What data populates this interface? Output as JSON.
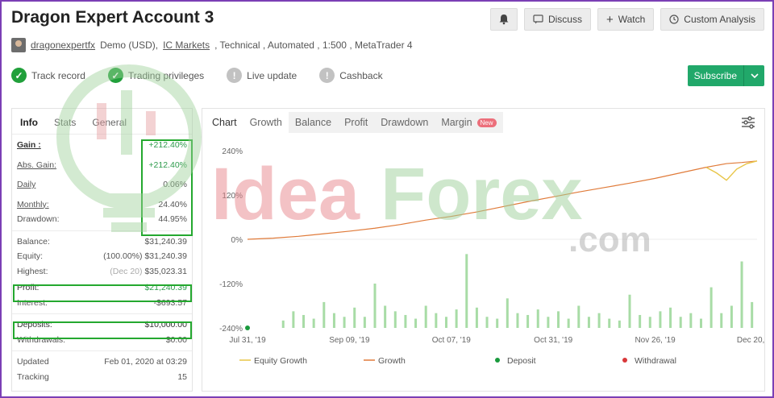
{
  "header": {
    "title": "Dragon Expert Account 3",
    "discuss_label": "Discuss",
    "watch_label": "Watch",
    "custom_label": "Custom Analysis"
  },
  "meta": {
    "username": "dragonexpertfx",
    "account_type": "Demo (USD),",
    "broker": "IC Markets",
    "details": ", Technical , Automated , 1:500 , MetaTrader 4"
  },
  "badges": [
    {
      "label": "Track record",
      "state": "ok"
    },
    {
      "label": "Trading privileges",
      "state": "ok"
    },
    {
      "label": "Live update",
      "state": "off"
    },
    {
      "label": "Cashback",
      "state": "off"
    }
  ],
  "subscribe_label": "Subscribe",
  "info": {
    "tabs": [
      "Info",
      "Stats",
      "General"
    ],
    "gain_label": "Gain :",
    "gain": "+212.40%",
    "abs_gain_label": "Abs. Gain:",
    "abs_gain": "+212.40%",
    "daily_label": "Daily",
    "daily": "0.06%",
    "monthly_label": "Monthly:",
    "monthly": "24.40%",
    "drawdown_label": "Drawdown:",
    "drawdown": "44.95%",
    "balance_label": "Balance:",
    "balance": "$31,240.39",
    "equity_label": "Equity:",
    "equity": "(100.00%) $31,240.39",
    "highest_label": "Highest:",
    "highest_date": "(Dec 20)",
    "highest": "$35,023.31",
    "profit_label": "Profit:",
    "profit": "$21,240.39",
    "interest_label": "Interest:",
    "interest": "-$693.57",
    "deposits_label": "Deposits:",
    "deposits": "$10,000.00",
    "withdrawals_label": "Withdrawals:",
    "withdrawals": "$0.00",
    "updated_label": "Updated",
    "updated": "Feb 01, 2020 at 03:29",
    "tracking_label": "Tracking",
    "tracking": "15"
  },
  "chart_tabs": {
    "label": "Chart",
    "items": [
      "Growth",
      "Balance",
      "Profit",
      "Drawdown",
      "Margin"
    ],
    "new_badge": "New"
  },
  "chart_data": {
    "type": "line",
    "y_ticks": [
      "240%",
      "120%",
      "0%",
      "-120%",
      "-240%"
    ],
    "ylim": [
      -240,
      240
    ],
    "x_ticks": [
      "Jul 31, '19",
      "Sep 09, '19",
      "Oct 07, '19",
      "Oct 31, '19",
      "Nov 26, '19",
      "Dec 20, '19"
    ],
    "legend": [
      "Equity Growth",
      "Growth",
      "Deposit",
      "Withdrawal"
    ],
    "colors": {
      "equity": "#e8c547",
      "growth": "#e07b3a",
      "deposit": "#1a9a3d",
      "withdrawal": "#d9383a",
      "bars": "#a8dca6"
    },
    "growth": [
      [
        0,
        0
      ],
      [
        0.05,
        3
      ],
      [
        0.1,
        8
      ],
      [
        0.15,
        15
      ],
      [
        0.2,
        22
      ],
      [
        0.25,
        30
      ],
      [
        0.3,
        40
      ],
      [
        0.35,
        52
      ],
      [
        0.4,
        62
      ],
      [
        0.45,
        74
      ],
      [
        0.5,
        88
      ],
      [
        0.55,
        102
      ],
      [
        0.6,
        115
      ],
      [
        0.65,
        128
      ],
      [
        0.7,
        140
      ],
      [
        0.75,
        152
      ],
      [
        0.8,
        165
      ],
      [
        0.85,
        180
      ],
      [
        0.9,
        195
      ],
      [
        0.94,
        205
      ],
      [
        0.97,
        208
      ],
      [
        1.0,
        212
      ]
    ],
    "equity": [
      [
        0.9,
        195
      ],
      [
        0.92,
        180
      ],
      [
        0.94,
        160
      ],
      [
        0.96,
        190
      ],
      [
        0.98,
        205
      ],
      [
        1.0,
        212
      ]
    ],
    "deposit_points": [
      [
        0,
        -240
      ]
    ],
    "bars": [
      [
        0.07,
        20
      ],
      [
        0.09,
        45
      ],
      [
        0.11,
        35
      ],
      [
        0.13,
        25
      ],
      [
        0.15,
        70
      ],
      [
        0.17,
        40
      ],
      [
        0.19,
        30
      ],
      [
        0.21,
        55
      ],
      [
        0.23,
        30
      ],
      [
        0.25,
        120
      ],
      [
        0.27,
        60
      ],
      [
        0.29,
        45
      ],
      [
        0.31,
        35
      ],
      [
        0.33,
        25
      ],
      [
        0.35,
        60
      ],
      [
        0.37,
        40
      ],
      [
        0.39,
        30
      ],
      [
        0.41,
        50
      ],
      [
        0.43,
        200
      ],
      [
        0.45,
        55
      ],
      [
        0.47,
        30
      ],
      [
        0.49,
        25
      ],
      [
        0.51,
        80
      ],
      [
        0.53,
        40
      ],
      [
        0.55,
        35
      ],
      [
        0.57,
        50
      ],
      [
        0.59,
        30
      ],
      [
        0.61,
        45
      ],
      [
        0.63,
        25
      ],
      [
        0.65,
        60
      ],
      [
        0.67,
        30
      ],
      [
        0.69,
        40
      ],
      [
        0.71,
        25
      ],
      [
        0.73,
        20
      ],
      [
        0.75,
        90
      ],
      [
        0.77,
        35
      ],
      [
        0.79,
        30
      ],
      [
        0.81,
        45
      ],
      [
        0.83,
        55
      ],
      [
        0.85,
        30
      ],
      [
        0.87,
        40
      ],
      [
        0.89,
        25
      ],
      [
        0.91,
        110
      ],
      [
        0.93,
        40
      ],
      [
        0.95,
        60
      ],
      [
        0.97,
        180
      ],
      [
        0.99,
        70
      ]
    ]
  }
}
